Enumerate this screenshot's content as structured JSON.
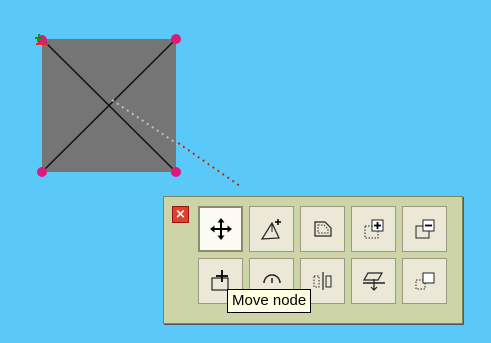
{
  "canvas": {
    "background": "#5ac8f8",
    "shape_fill": "#757575",
    "node_color": "#e01878",
    "connector_color": "#8b3a1a"
  },
  "toolbar": {
    "close_icon": "close-x-icon",
    "close_label": "×",
    "tools": [
      {
        "name": "move-node-tool",
        "icon": "four-arrows-icon"
      },
      {
        "name": "add-node-tool",
        "icon": "pen-plus-icon"
      },
      {
        "name": "shape-edit-tool",
        "icon": "cut-rectangle-icon"
      },
      {
        "name": "add-point-tool",
        "icon": "plus-box-icon"
      },
      {
        "name": "remove-point-tool",
        "icon": "minus-box-icon"
      },
      {
        "name": "move-frame-tool",
        "icon": "frame-move-icon"
      },
      {
        "name": "rotate-tool",
        "icon": "rotate-icon"
      },
      {
        "name": "align-tool",
        "icon": "align-icon"
      },
      {
        "name": "flip-tool",
        "icon": "flip-icon"
      },
      {
        "name": "scale-tool",
        "icon": "scale-box-icon"
      }
    ]
  },
  "tooltip": {
    "text": "Move node"
  }
}
